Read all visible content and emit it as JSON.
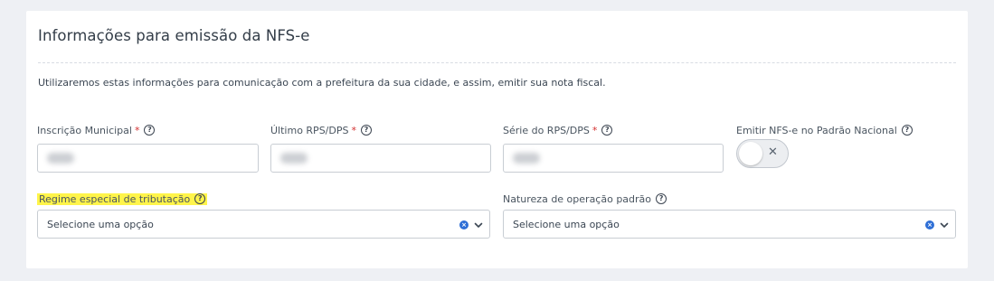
{
  "section": {
    "title": "Informações para emissão da NFS-e",
    "description": "Utilizaremos estas informações para comunicação com a prefeitura da sua cidade, e assim, emitir sua nota fiscal."
  },
  "fields": {
    "inscricao": {
      "label": "Inscrição Municipal",
      "required_mark": "*"
    },
    "ultimo_rps": {
      "label": "Último RPS/DPS",
      "required_mark": "*"
    },
    "serie_rps": {
      "label": "Série do RPS/DPS",
      "required_mark": "*"
    },
    "padrao_nacional": {
      "label": "Emitir NFS-e no Padrão Nacional",
      "toggle_state": "off"
    },
    "regime": {
      "label": "Regime especial de tributação",
      "placeholder": "Selecione uma opção",
      "highlight_color": "#fff44a"
    },
    "natureza": {
      "label": "Natureza de operação padrão",
      "placeholder": "Selecione uma opção"
    }
  },
  "icons": {
    "help": "?",
    "toggle_off": "✕",
    "clear": "×"
  },
  "colors": {
    "required": "#d32f2f",
    "clear_icon": "#2f6fd6",
    "background": "#eef0f4"
  }
}
